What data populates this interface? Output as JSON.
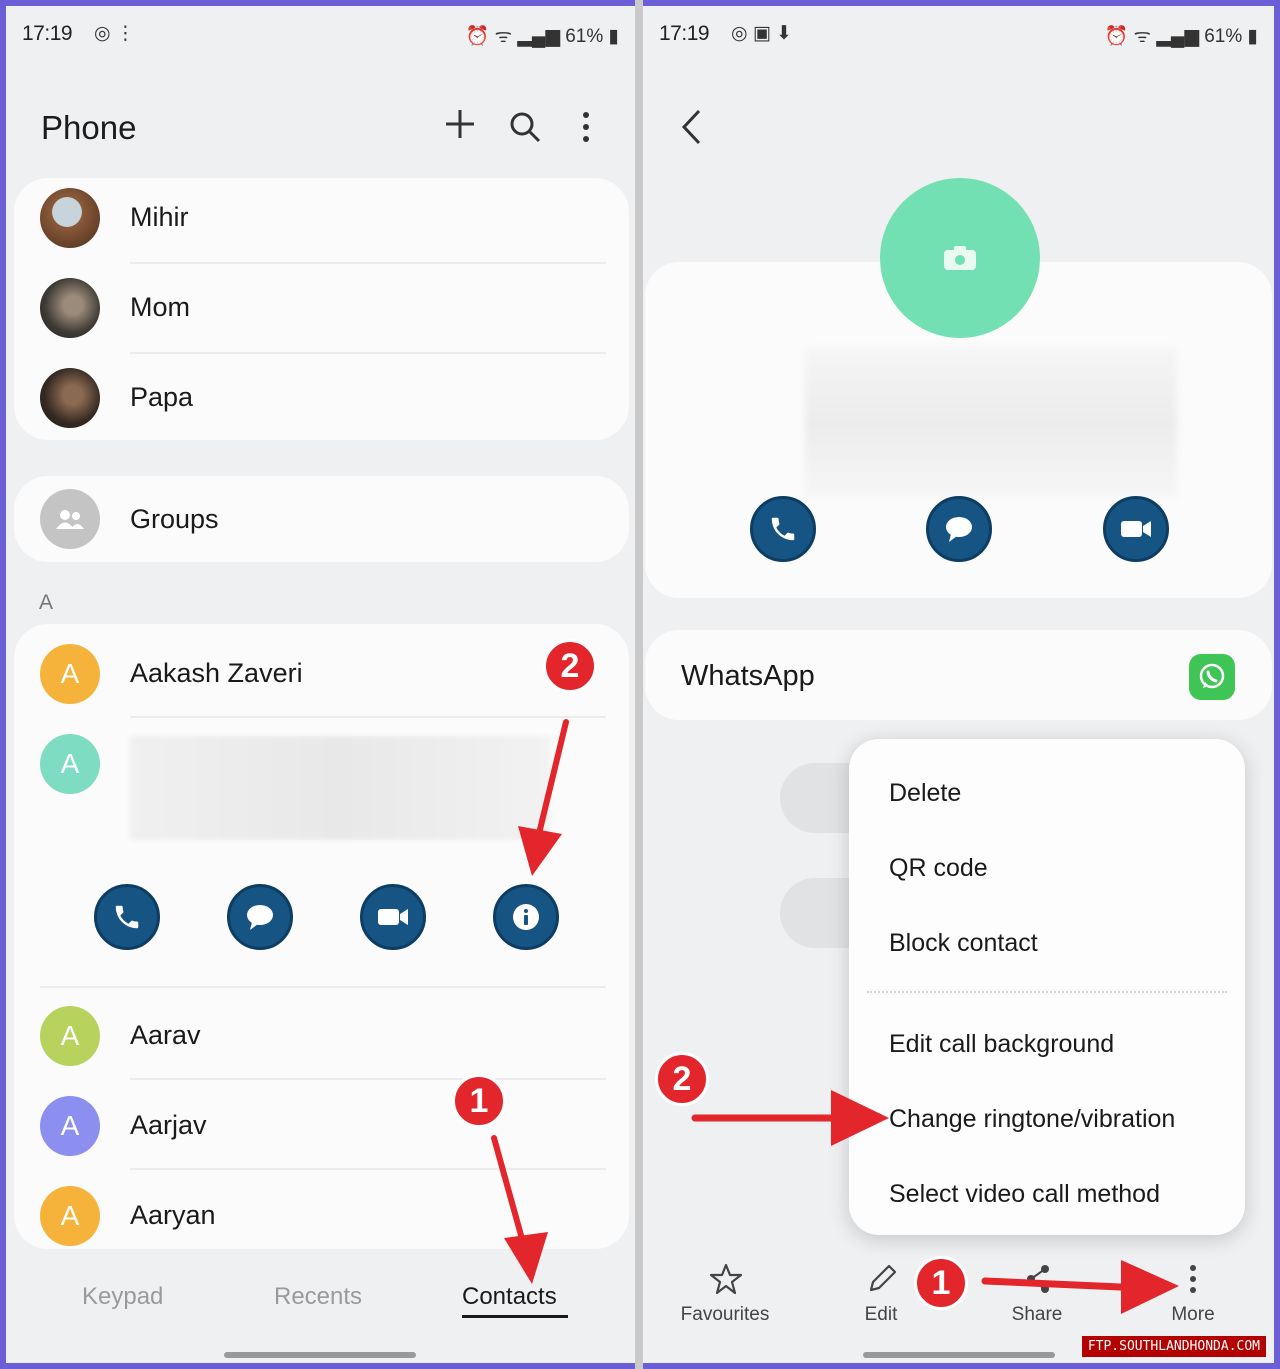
{
  "left": {
    "status": {
      "time": "17:19",
      "right": "61%"
    },
    "header": {
      "title": "Phone"
    },
    "favourites": [
      {
        "name": "Mihir"
      },
      {
        "name": "Mom"
      },
      {
        "name": "Papa"
      }
    ],
    "groups_label": "Groups",
    "section_letter": "A",
    "contacts": [
      {
        "initial": "A",
        "name": "Aakash Zaveri",
        "color": "#f5b33c"
      },
      {
        "initial": "A",
        "name": "",
        "color": "#7ddcc2"
      },
      {
        "initial": "A",
        "name": "Aarav",
        "color": "#b8d25e"
      },
      {
        "initial": "A",
        "name": "Aarjav",
        "color": "#8c8ff0"
      },
      {
        "initial": "A",
        "name": "Aaryan",
        "color": "#f5b33c"
      }
    ],
    "tabs": [
      "Keypad",
      "Recents",
      "Contacts"
    ],
    "badges": {
      "one": "1",
      "two": "2"
    }
  },
  "right": {
    "status": {
      "time": "17:19",
      "right": "61%"
    },
    "whatsapp_label": "WhatsApp",
    "menu": [
      "Delete",
      "QR code",
      "Block contact",
      "Edit call background",
      "Change ringtone/vibration",
      "Select video call method"
    ],
    "bottom_actions": [
      "Favourites",
      "Edit",
      "Share",
      "More"
    ],
    "badges": {
      "one": "1",
      "two": "2"
    },
    "watermark": "FTP.SOUTHLANDHONDA.COM"
  }
}
